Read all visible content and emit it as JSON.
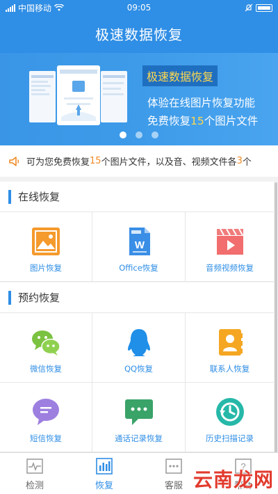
{
  "status": {
    "carrier": "中国移动",
    "time": "09:05"
  },
  "header": {
    "title": "极速数据恢复"
  },
  "banner": {
    "title": "极速数据恢复",
    "line1": "体验在线图片恢复功能",
    "line2_prefix": "免费恢复",
    "line2_number": "15",
    "line2_suffix": "个图片文件",
    "dots": 3,
    "active_dot": 0
  },
  "notice": {
    "part1": "可为您免费恢复",
    "num1": "15",
    "part2": "个图片文件，以及音、视频文件各",
    "num2": "3",
    "part3": "个"
  },
  "online": {
    "title": "在线恢复",
    "items": [
      {
        "label": "图片恢复",
        "icon": "image-icon"
      },
      {
        "label": "Office恢复",
        "icon": "office-doc-icon"
      },
      {
        "label": "音频视频恢复",
        "icon": "video-clapper-icon"
      }
    ]
  },
  "reserve": {
    "title": "预约恢复",
    "items": [
      {
        "label": "微信恢复",
        "icon": "wechat-icon"
      },
      {
        "label": "QQ恢复",
        "icon": "qq-icon"
      },
      {
        "label": "联系人恢复",
        "icon": "contacts-icon"
      },
      {
        "label": "短信恢复",
        "icon": "sms-icon"
      },
      {
        "label": "通话记录恢复",
        "icon": "call-log-icon"
      },
      {
        "label": "历史扫描记录",
        "icon": "history-icon"
      }
    ]
  },
  "nav": [
    {
      "label": "检测",
      "icon": "detect-icon",
      "active": false
    },
    {
      "label": "恢复",
      "icon": "restore-icon",
      "active": true
    },
    {
      "label": "客服",
      "icon": "service-icon",
      "active": false
    },
    {
      "label": "帮助",
      "icon": "help-icon",
      "active": false
    }
  ],
  "watermark": "云南龙网",
  "colors": {
    "primary": "#2f8ee5",
    "highlight": "#f08a24",
    "banner_accent": "#ffd84d"
  }
}
